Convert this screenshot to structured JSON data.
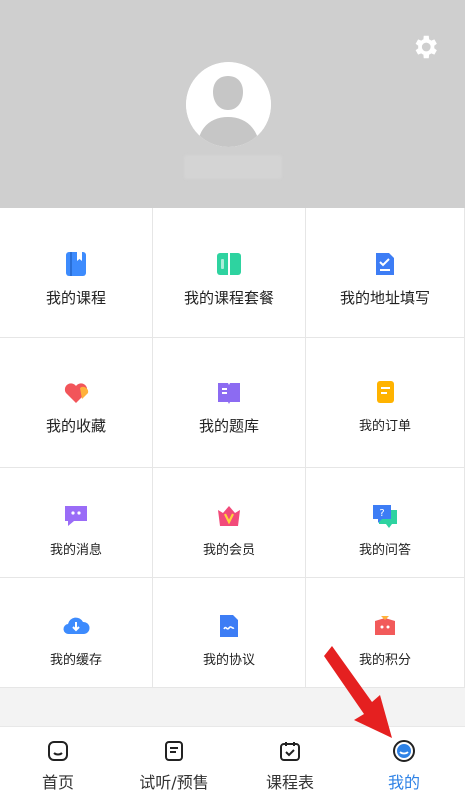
{
  "header": {
    "settings_icon": "gear-icon",
    "avatar_icon": "avatar-icon"
  },
  "menu": {
    "items": [
      {
        "label": "我的课程",
        "icon": "book-icon"
      },
      {
        "label": "我的课程套餐",
        "icon": "open-book-icon"
      },
      {
        "label": "我的地址填写",
        "icon": "checklist-icon"
      },
      {
        "label": "我的收藏",
        "icon": "heart-icon"
      },
      {
        "label": "我的题库",
        "icon": "question-bank-icon"
      },
      {
        "label": "我的订单",
        "icon": "order-icon"
      },
      {
        "label": "我的消息",
        "icon": "message-icon"
      },
      {
        "label": "我的会员",
        "icon": "vip-icon"
      },
      {
        "label": "我的问答",
        "icon": "qa-icon"
      },
      {
        "label": "我的缓存",
        "icon": "cloud-download-icon"
      },
      {
        "label": "我的协议",
        "icon": "agreement-icon"
      },
      {
        "label": "我的积分",
        "icon": "points-icon"
      }
    ]
  },
  "tabs": [
    {
      "label": "首页",
      "icon": "home-icon"
    },
    {
      "label": "试听/预售",
      "icon": "document-icon"
    },
    {
      "label": "课程表",
      "icon": "calendar-check-icon"
    },
    {
      "label": "我的",
      "icon": "profile-icon"
    }
  ],
  "colors": {
    "accent": "#2e82e6",
    "header_bg": "#cfcfcf",
    "arrow": "#e52020"
  }
}
